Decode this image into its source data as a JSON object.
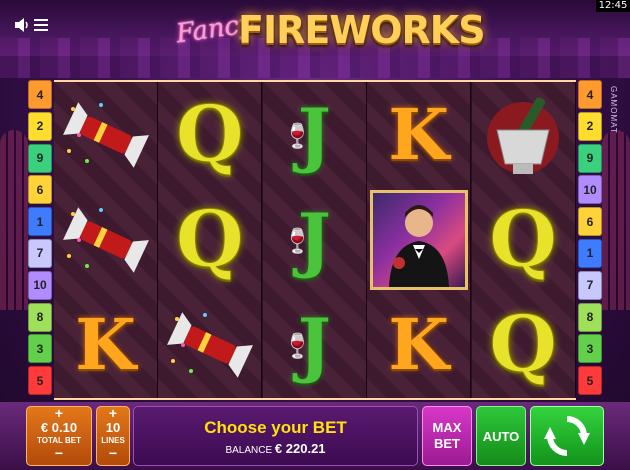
{
  "status": {
    "time": "12:45"
  },
  "title": {
    "fancy": "Fancy",
    "main": "FIREWORKS"
  },
  "brand": "GAMOMAT",
  "paylines_left": [
    "4",
    "2",
    "9",
    "6",
    "1",
    "7",
    "10",
    "8",
    "3",
    "5"
  ],
  "paylines_right": [
    "4",
    "2",
    "9",
    "10",
    "6",
    "1",
    "7",
    "8",
    "3",
    "5"
  ],
  "payline_colors": [
    "#3f7bff",
    "#ffdd2e",
    "#62d04a",
    "#ff9b2e",
    "#ff3a3a",
    "#ffd23a",
    "#c8c8ff",
    "#9ee05a",
    "#3ad07e",
    "#b08cff"
  ],
  "reels": [
    [
      "cracker-icon",
      "cracker-icon",
      "K"
    ],
    [
      "Q",
      "Q",
      "cracker-icon"
    ],
    [
      "J",
      "J",
      "J"
    ],
    [
      "K",
      "man-icon",
      "K"
    ],
    [
      "champagne-icon",
      "Q",
      "Q"
    ]
  ],
  "controls": {
    "total_bet": {
      "plus": "+",
      "value": "€ 0.10",
      "label": "TOTAL BET",
      "minus": "−"
    },
    "lines": {
      "plus": "+",
      "value": "10",
      "label": "LINES",
      "minus": "−"
    },
    "message": "Choose your BET",
    "balance_label": "BALANCE",
    "balance_value": "€ 220.21",
    "max_bet": "MAX BET",
    "auto": "AUTO"
  }
}
